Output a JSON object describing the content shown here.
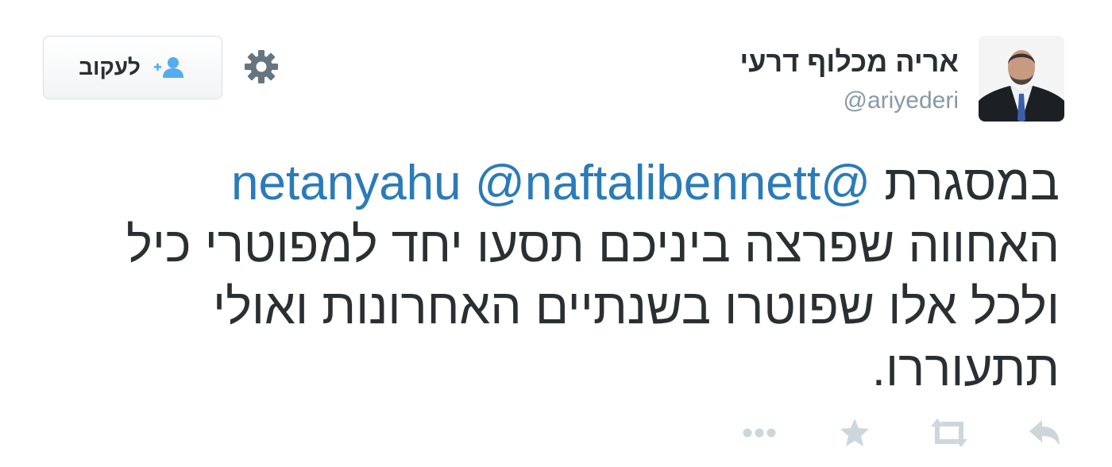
{
  "user": {
    "display_name": "אריה מכלוף דרעי",
    "screen_name": "@ariyederi"
  },
  "follow_button": {
    "label": "לעקוב",
    "icon": "add-user-icon"
  },
  "settings": {
    "icon": "gear-icon"
  },
  "tweet": {
    "mentions": [
      "@netanyahu",
      "@naftalibennett"
    ],
    "text_start": "במסגרת",
    "text_rest": "האחווה שפרצה ביניכם תסעו יחד למפוטרי כיל ולכל אלו שפוטרו בשנתיים האחרונות ואולי תתעוררו."
  },
  "actions": [
    "reply-icon",
    "retweet-icon",
    "favorite-icon",
    "more-icon"
  ],
  "colors": {
    "mention": "#2b7bb9",
    "text": "#292f33",
    "muted": "#8899a6",
    "icon": "#ccd6dd",
    "follow_icon": "#55acee"
  }
}
